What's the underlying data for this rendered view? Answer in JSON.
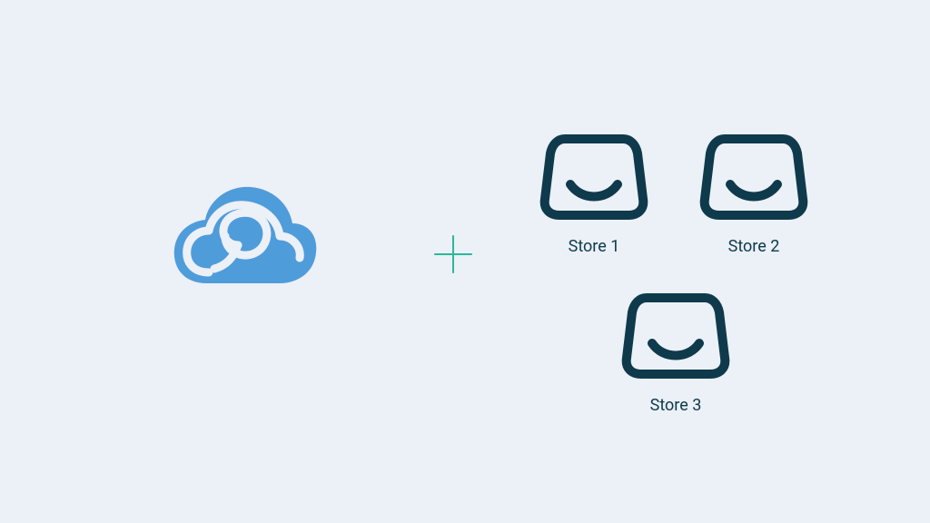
{
  "diagram": {
    "left_entity": "cloud-service",
    "operator": "plus",
    "right_group": "stores"
  },
  "stores": [
    {
      "label": "Store 1"
    },
    {
      "label": "Store 2"
    },
    {
      "label": "Store 3"
    }
  ],
  "colors": {
    "background": "#ecf0f7",
    "cloud_blue": "#4F9CDB",
    "plus_green": "#2BB89A",
    "store_dark": "#0E3A4C",
    "text": "#0e3a4c"
  }
}
